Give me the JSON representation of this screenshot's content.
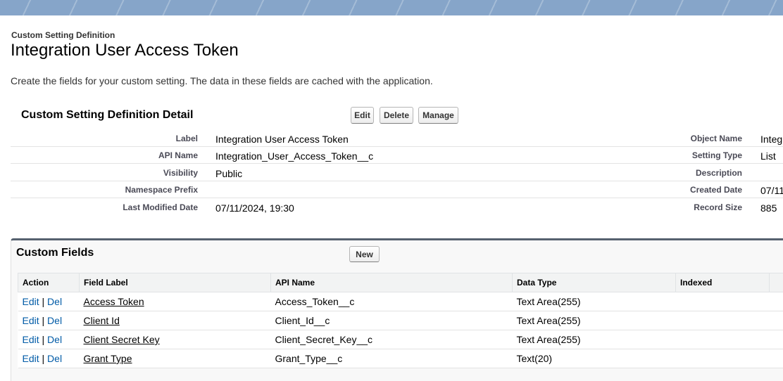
{
  "header": {
    "breadcrumb": "Custom Setting Definition",
    "title": "Integration User Access Token",
    "description": "Create the fields for your custom setting. The data in these fields are cached with the application."
  },
  "detail": {
    "section_title": "Custom Setting Definition Detail",
    "buttons": {
      "edit": "Edit",
      "delete": "Delete",
      "manage": "Manage"
    },
    "left_rows": [
      {
        "label": "Label",
        "value": "Integration User Access Token"
      },
      {
        "label": "API Name",
        "value": "Integration_User_Access_Token__c"
      },
      {
        "label": "Visibility",
        "value": "Public"
      },
      {
        "label": "Namespace Prefix",
        "value": ""
      },
      {
        "label": "Last Modified Date",
        "value": "07/11/2024, 19:30"
      }
    ],
    "right_rows": [
      {
        "label": "Object Name",
        "value": "Integ"
      },
      {
        "label": "Setting Type",
        "value": "List"
      },
      {
        "label": "Description",
        "value": ""
      },
      {
        "label": "Created Date",
        "value": "07/11"
      },
      {
        "label": "Record Size",
        "value": "885"
      }
    ]
  },
  "custom_fields": {
    "title": "Custom Fields",
    "new_button": "New",
    "columns": [
      "Action",
      "Field Label",
      "API Name",
      "Data Type",
      "Indexed"
    ],
    "action_edit": "Edit",
    "action_sep": "|",
    "action_del": "Del",
    "rows": [
      {
        "label": "Access Token",
        "api_name": "Access_Token__c",
        "data_type": "Text Area(255)",
        "indexed": ""
      },
      {
        "label": "Client Id",
        "api_name": "Client_Id__c",
        "data_type": "Text Area(255)",
        "indexed": ""
      },
      {
        "label": "Client Secret Key",
        "api_name": "Client_Secret_Key__c",
        "data_type": "Text Area(255)",
        "indexed": ""
      },
      {
        "label": "Grant Type",
        "api_name": "Grant_Type__c",
        "data_type": "Text(20)",
        "indexed": ""
      }
    ]
  }
}
